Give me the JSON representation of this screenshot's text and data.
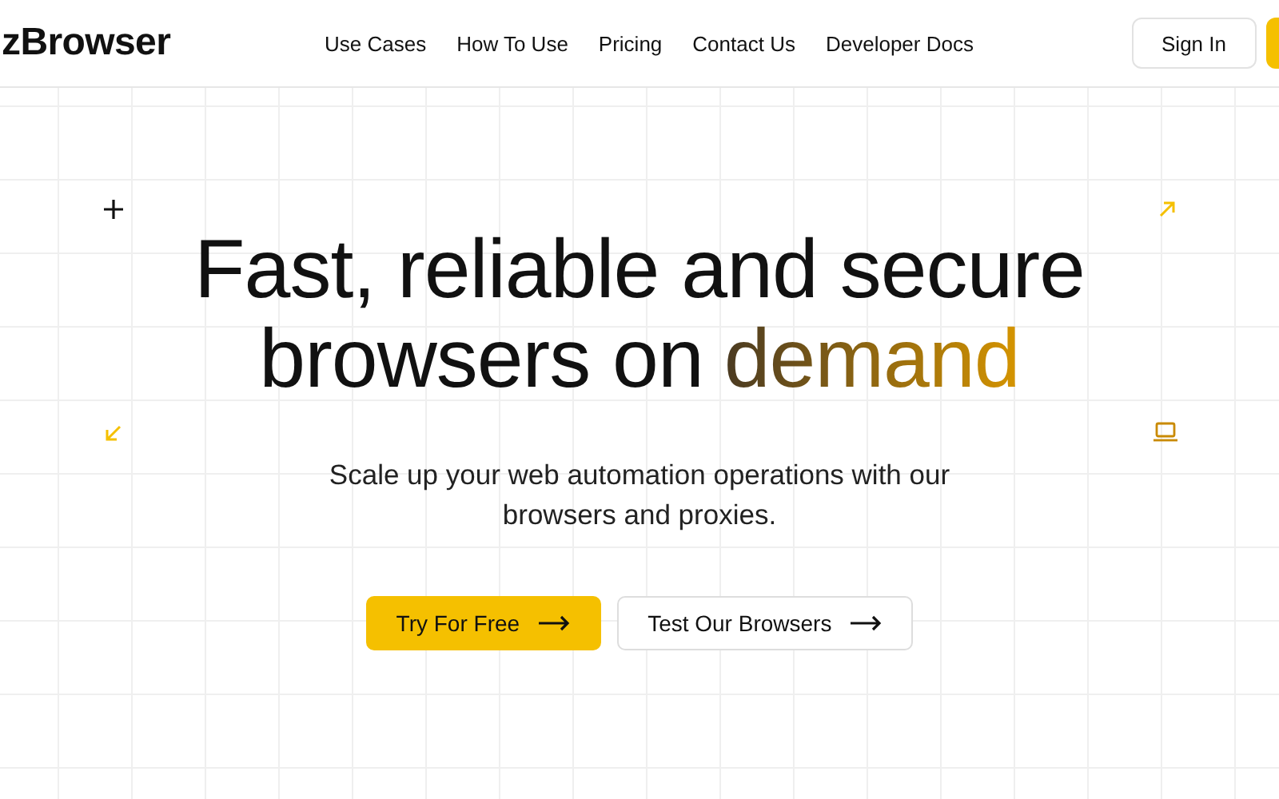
{
  "header": {
    "logo": "zBrowser",
    "nav": [
      "Use Cases",
      "How To Use",
      "Pricing",
      "Contact Us",
      "Developer Docs"
    ],
    "sign_in": "Sign In"
  },
  "hero": {
    "headline_line_1": "Fast, reliable and secure",
    "headline_line_2": "browsers on",
    "headline_highlight": "demand",
    "subtitle": "Scale up your web automation operations with our browsers and proxies.",
    "buttons": [
      {
        "label": "Try For Free",
        "kind": "primary"
      },
      {
        "label": "Test Our Browsers",
        "kind": "secondary"
      }
    ]
  }
}
